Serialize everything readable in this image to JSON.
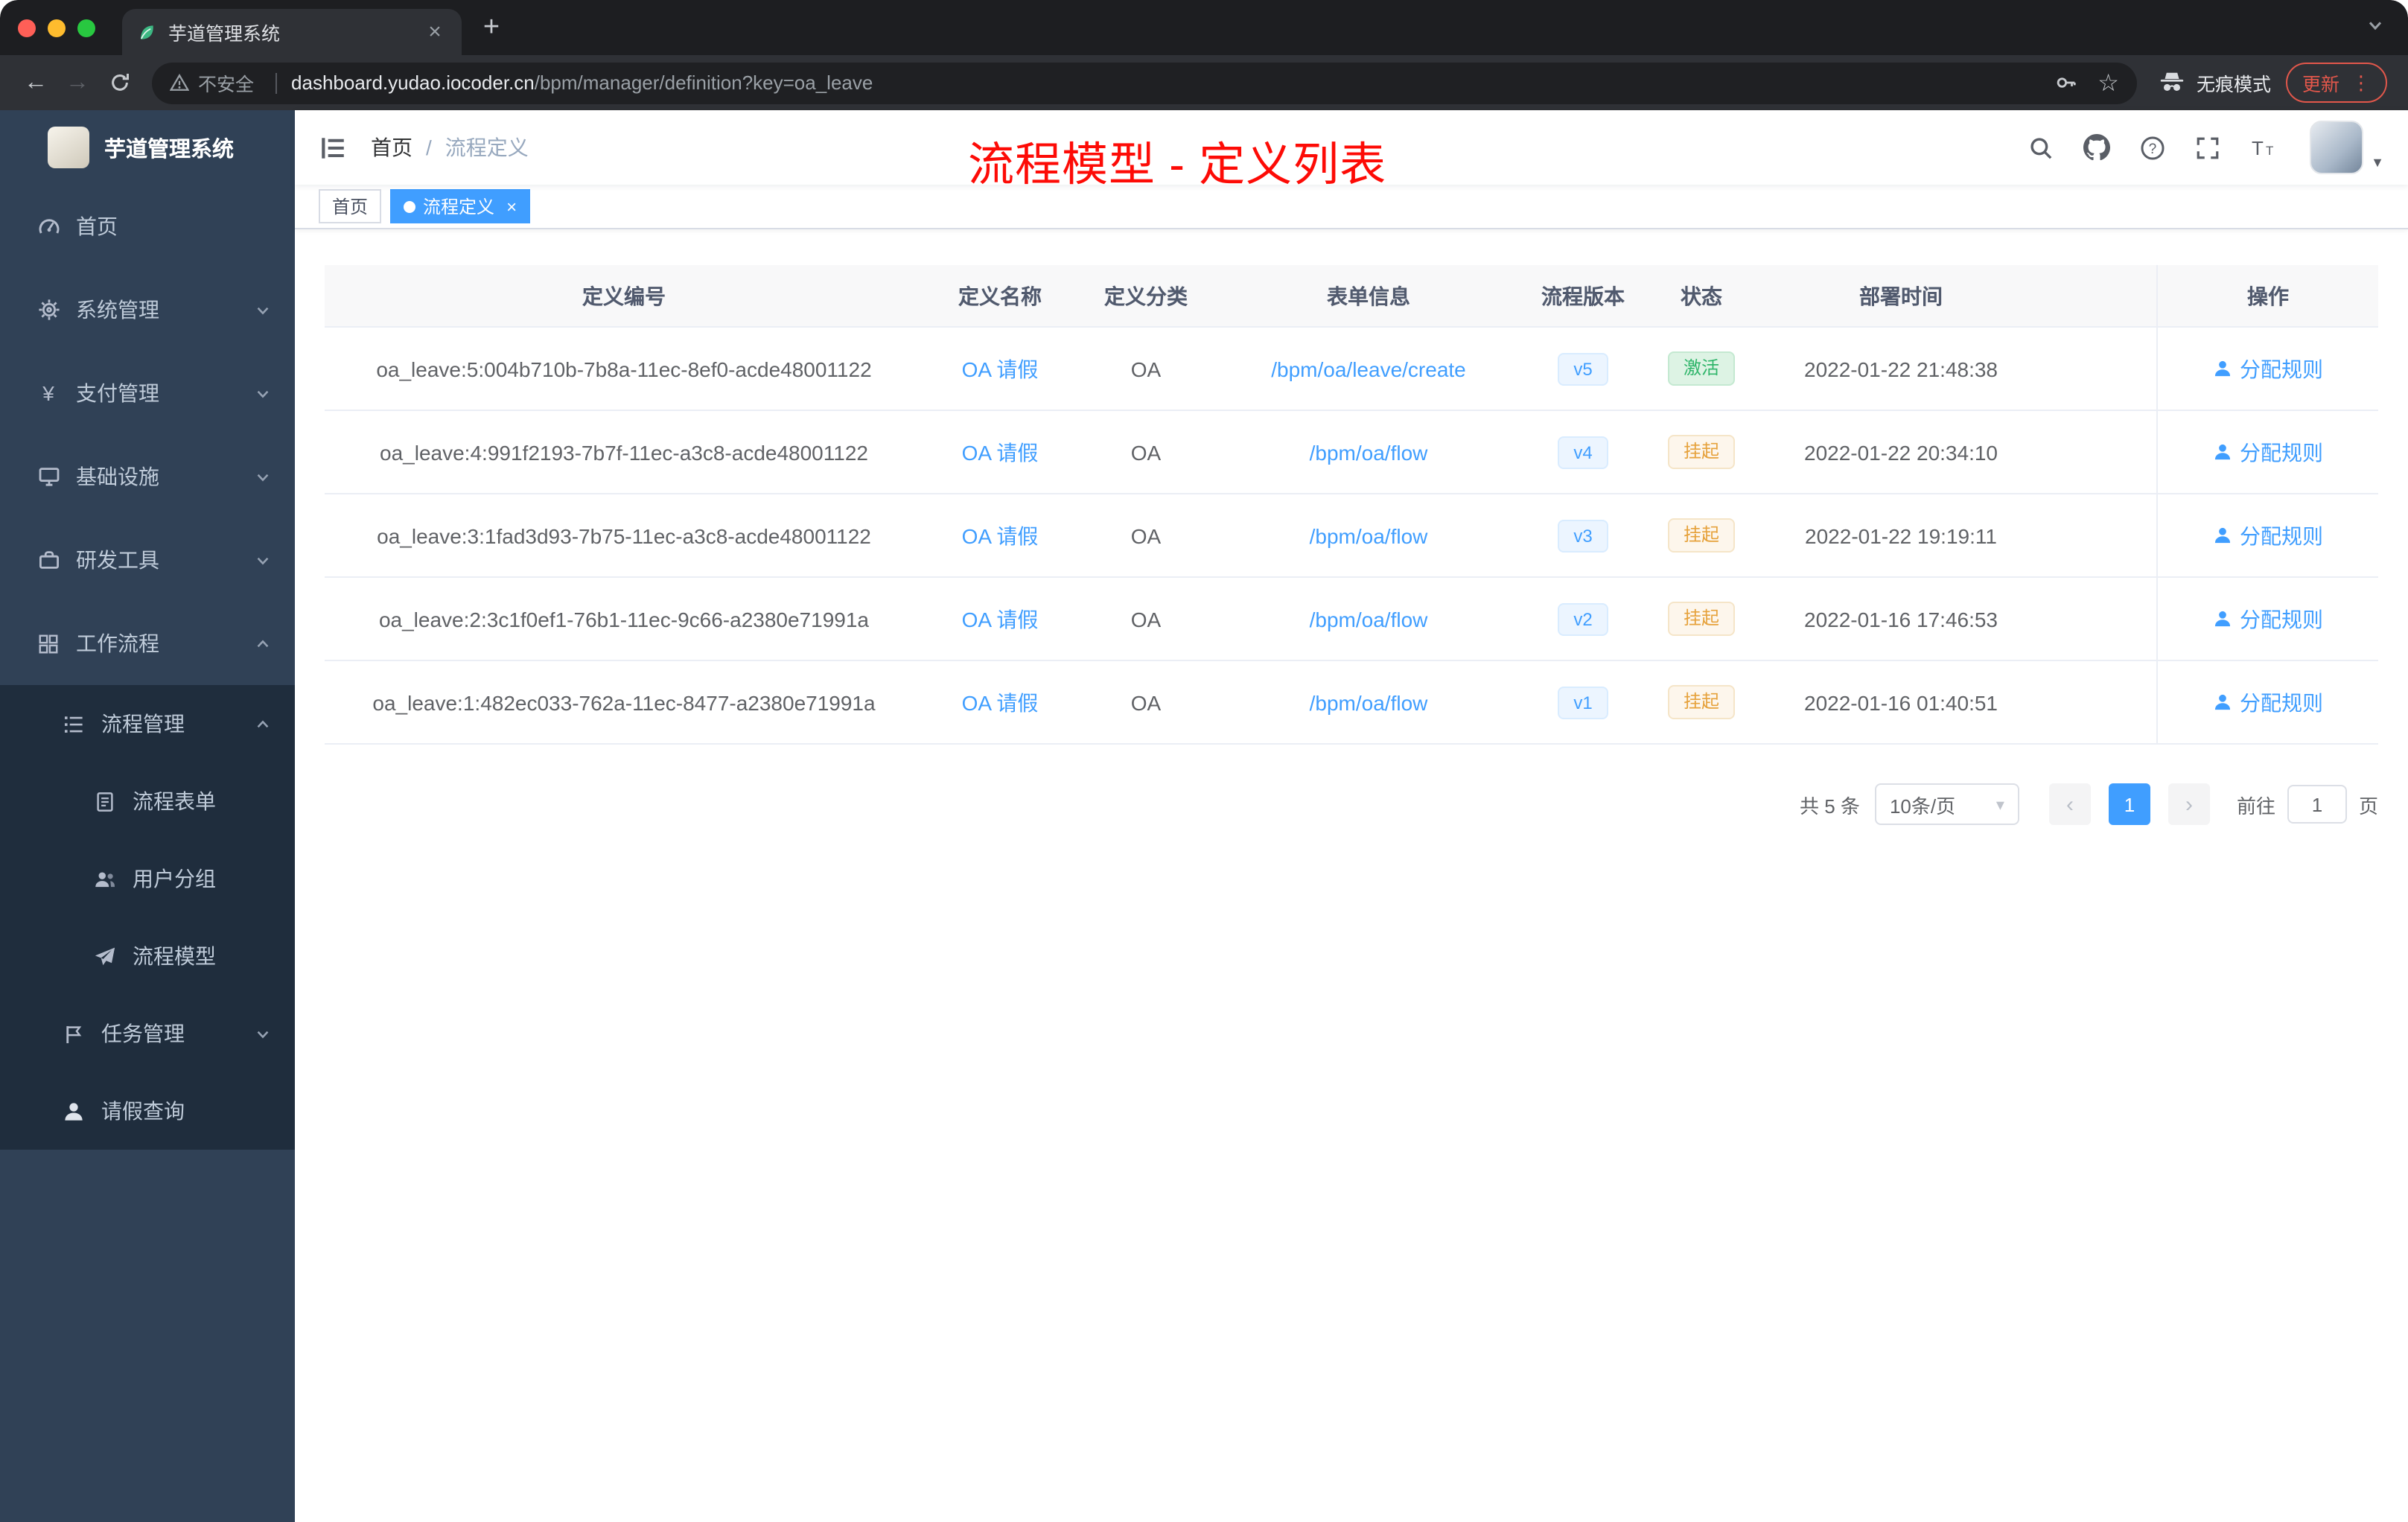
{
  "browser": {
    "tab_title": "芋道管理系统",
    "security_label": "不安全",
    "url_host": "dashboard.yudao.iocoder.cn",
    "url_path": "/bpm/manager/definition?key=oa_leave",
    "incognito_label": "无痕模式",
    "update_label": "更新"
  },
  "glyphs": {
    "new_tab": "+",
    "tab_close": "×",
    "back": "←",
    "forward": "→",
    "star": "☆",
    "kebab": "⋮",
    "yen": "¥",
    "breadcrumb_sep": "/",
    "tag_close": "×",
    "question": "?",
    "prev": "‹",
    "next": "›",
    "caret": "▾",
    "avatar_caret": "▼"
  },
  "sidebar": {
    "logo_title": "芋道管理系统",
    "items": [
      {
        "label": "首页"
      },
      {
        "label": "系统管理"
      },
      {
        "label": "支付管理"
      },
      {
        "label": "基础设施"
      },
      {
        "label": "研发工具"
      },
      {
        "label": "工作流程"
      }
    ],
    "workflow": {
      "process_mgmt": {
        "label": "流程管理",
        "children": [
          {
            "label": "流程表单"
          },
          {
            "label": "用户分组"
          },
          {
            "label": "流程模型"
          }
        ]
      },
      "task_mgmt": {
        "label": "任务管理"
      },
      "leave_query": {
        "label": "请假查询"
      }
    }
  },
  "header": {
    "breadcrumb_home": "首页",
    "breadcrumb_current": "流程定义",
    "annotation": "流程模型 - 定义列表"
  },
  "tags": {
    "home": "首页",
    "active": "流程定义"
  },
  "table": {
    "columns": {
      "id": "定义编号",
      "name": "定义名称",
      "category": "定义分类",
      "form": "表单信息",
      "version": "流程版本",
      "status": "状态",
      "time": "部署时间",
      "action": "操作"
    },
    "rows": [
      {
        "id": "oa_leave:5:004b710b-7b8a-11ec-8ef0-acde48001122",
        "name": "OA 请假",
        "category": "OA",
        "form": "/bpm/oa/leave/create",
        "version": "v5",
        "status": "激活",
        "time": "2022-01-22 21:48:38",
        "action": "分配规则"
      },
      {
        "id": "oa_leave:4:991f2193-7b7f-11ec-a3c8-acde48001122",
        "name": "OA 请假",
        "category": "OA",
        "form": "/bpm/oa/flow",
        "version": "v4",
        "status": "挂起",
        "time": "2022-01-22 20:34:10",
        "action": "分配规则"
      },
      {
        "id": "oa_leave:3:1fad3d93-7b75-11ec-a3c8-acde48001122",
        "name": "OA 请假",
        "category": "OA",
        "form": "/bpm/oa/flow",
        "version": "v3",
        "status": "挂起",
        "time": "2022-01-22 19:19:11",
        "action": "分配规则"
      },
      {
        "id": "oa_leave:2:3c1f0ef1-76b1-11ec-9c66-a2380e71991a",
        "name": "OA 请假",
        "category": "OA",
        "form": "/bpm/oa/flow",
        "version": "v2",
        "status": "挂起",
        "time": "2022-01-16 17:46:53",
        "action": "分配规则"
      },
      {
        "id": "oa_leave:1:482ec033-762a-11ec-8477-a2380e71991a",
        "name": "OA 请假",
        "category": "OA",
        "form": "/bpm/oa/flow",
        "version": "v1",
        "status": "挂起",
        "time": "2022-01-16 01:40:51",
        "action": "分配规则"
      }
    ]
  },
  "pagination": {
    "total": "共 5 条",
    "page_size": "10条/页",
    "page": "1",
    "goto_label": "前往",
    "goto_value": "1",
    "unit_label": "页"
  },
  "colors": {
    "accent": "#409eff",
    "success": "#2fb56a",
    "warning": "#e6a23c",
    "annotation_red": "#fd0b06",
    "sidebar_bg": "#304156",
    "submenu_bg": "#1f2d3d"
  }
}
